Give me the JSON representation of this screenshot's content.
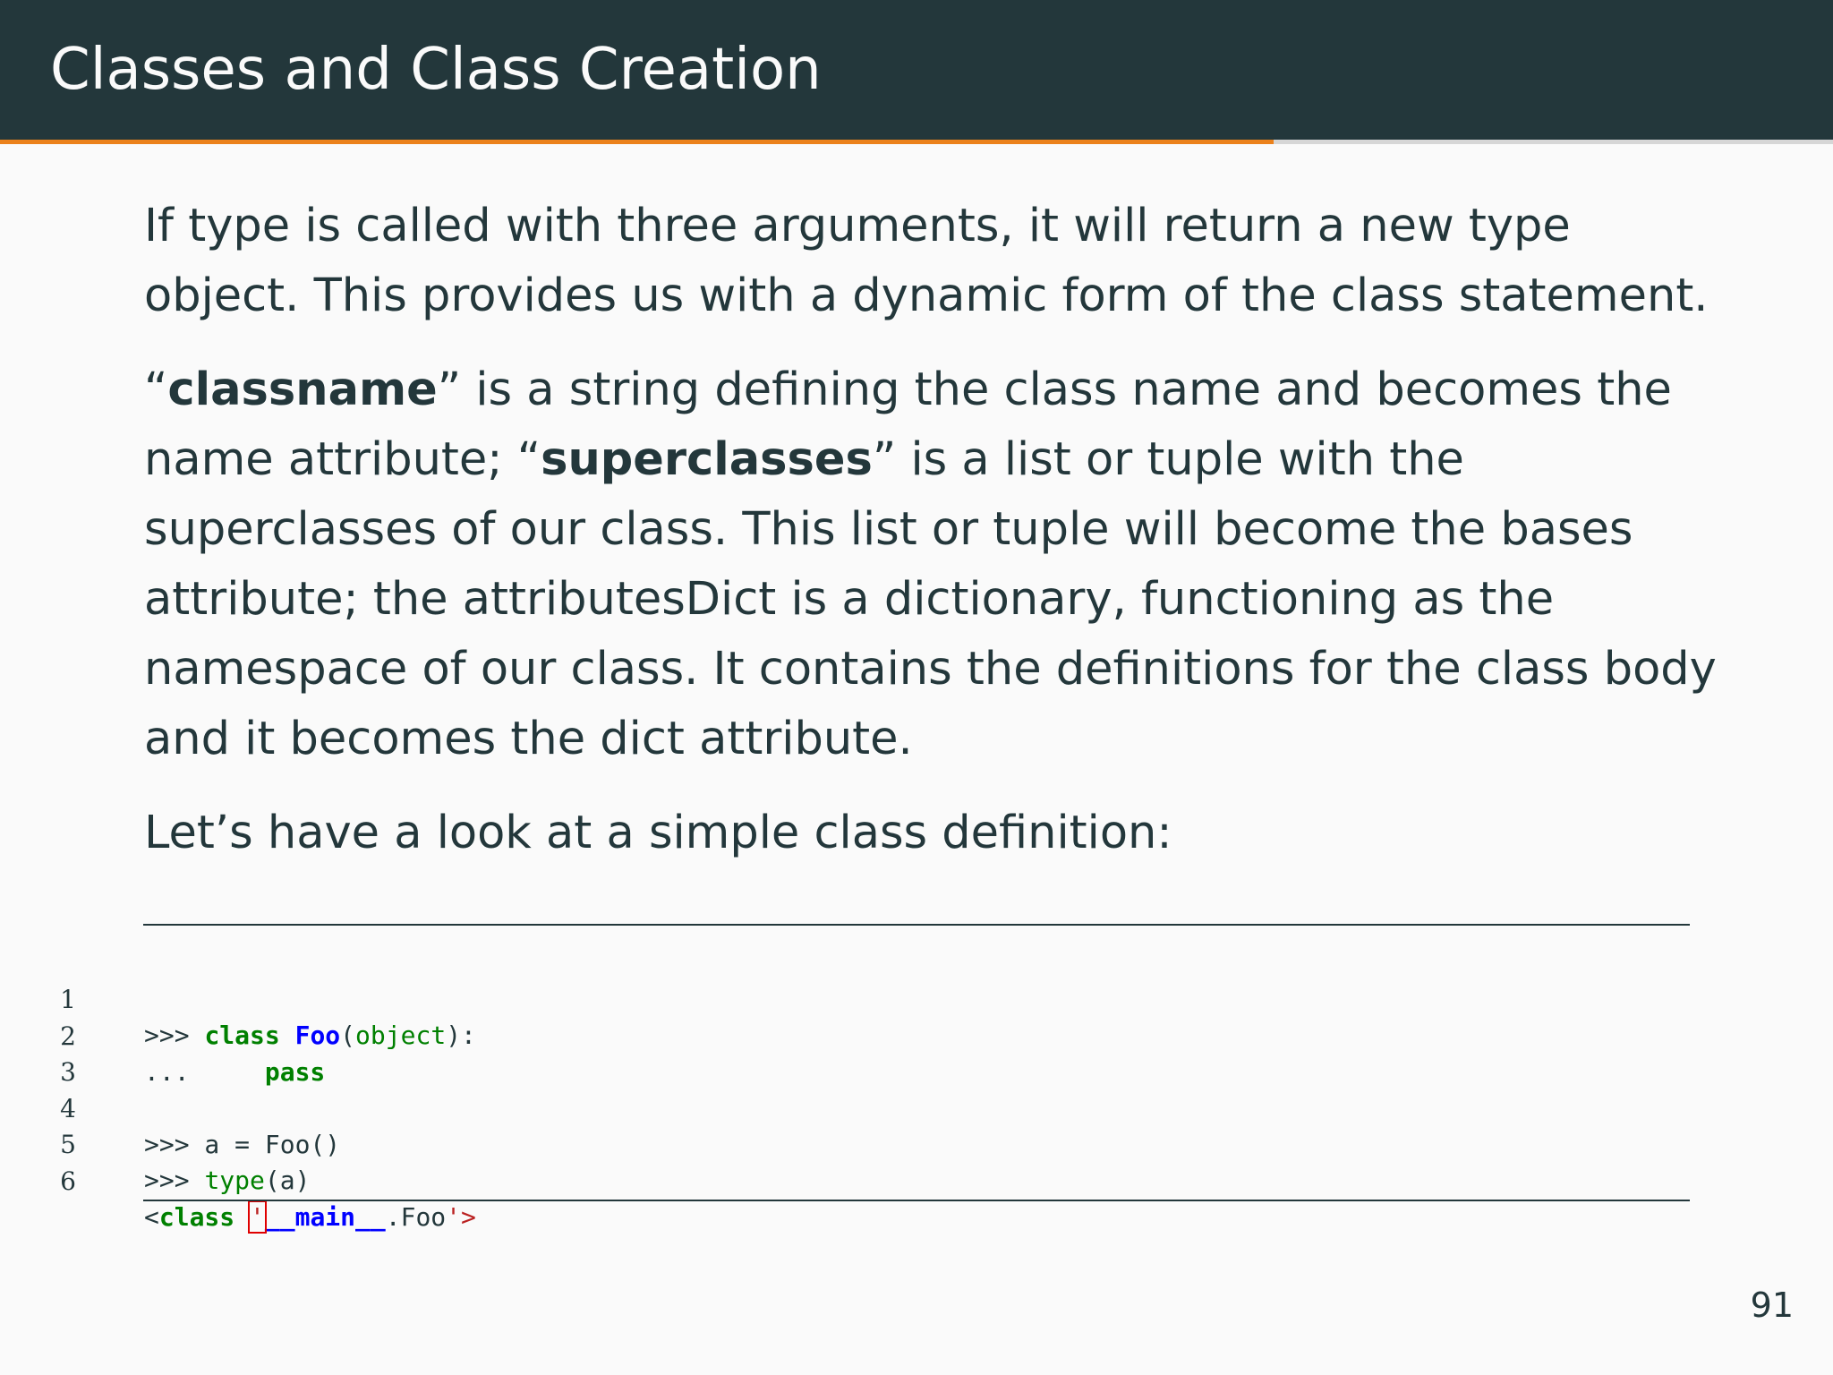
{
  "slide": {
    "title": "Classes and Class Creation",
    "page_number": "91",
    "progress": 0.695
  },
  "paragraphs": {
    "p1": "If type is called with three arguments, it will return a new type object. This provides us with a dynamic form of the class statement.",
    "p2_part1": "“",
    "p2_bold1": "classname",
    "p2_part2": "” is a string defining the class name and becomes the name attribute; “",
    "p2_bold2": "superclasses",
    "p2_part3": "” is a list or tuple with the superclasses of our class. This list or tuple will become the bases attribute; the attributesDict is a dictionary, functioning as the namespace of our class. It contains the definitions for the class body and it becomes the dict attribute.",
    "p3": "Let’s have a look at a simple class definition:"
  },
  "code": {
    "line_numbers": [
      "1",
      "2",
      "3",
      "4",
      "5",
      "6"
    ],
    "l1": {
      "prompt": ">>> ",
      "kw": "class",
      "sp": " ",
      "name": "Foo",
      "rest_open": "(",
      "builtin": "object",
      "rest_close": "):"
    },
    "l2": {
      "prompt": "...     ",
      "kw": "pass"
    },
    "l4": {
      "text": ">>> a = Foo()"
    },
    "l5": {
      "prompt": ">>> ",
      "builtin": "type",
      "rest": "(a)"
    },
    "l6": {
      "lt": "<",
      "kw": "class",
      "sp": " ",
      "quote": "'",
      "name": "__main__",
      "rest": ".Foo",
      "close": "'>"
    }
  },
  "colors": {
    "header_bg": "#23373b",
    "accent": "#eb811b",
    "keyword": "#008000",
    "name": "#0000ff",
    "string": "#ba2121"
  }
}
